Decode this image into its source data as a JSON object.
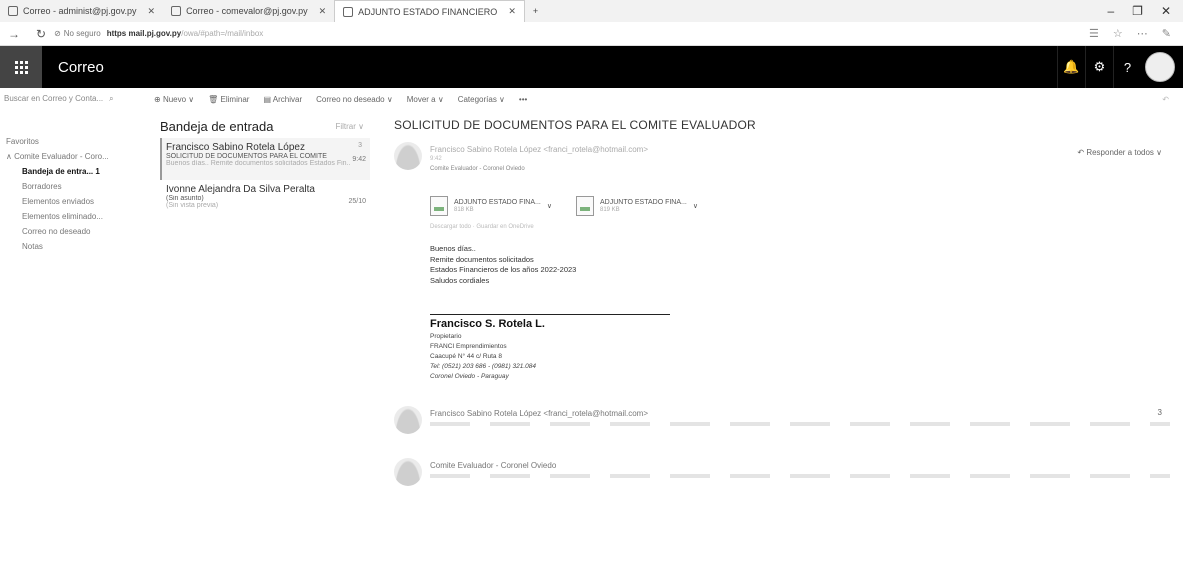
{
  "browser": {
    "tabs": [
      {
        "label": "Correo - administ@pj.gov.py"
      },
      {
        "label": "Correo - comevalor@pj.gov.py"
      },
      {
        "label": "ADJUNTO ESTADO FINANCIERO"
      }
    ],
    "security_label": "No seguro",
    "url_host": "https  mail.pj.gov.py",
    "url_path": "/owa/#path=/mail/inbox"
  },
  "app": {
    "title": "Correo"
  },
  "search": {
    "placeholder": "Buscar en Correo y Conta..."
  },
  "commands": {
    "new": "Nuevo",
    "delete": "Eliminar",
    "archive": "Archivar",
    "junk": "Correo no deseado",
    "move": "Mover a",
    "categories": "Categorías",
    "more": "•••"
  },
  "folders": {
    "favorites": "Favoritos",
    "account": "Comite Evaluador - Coro...",
    "items": [
      {
        "label": "Bandeja de entra... 1"
      },
      {
        "label": "Borradores"
      },
      {
        "label": "Elementos enviados"
      },
      {
        "label": "Elementos eliminado..."
      },
      {
        "label": "Correo no deseado"
      },
      {
        "label": "Notas"
      }
    ]
  },
  "message_list": {
    "title": "Bandeja de entrada",
    "filter": "Filtrar",
    "messages": [
      {
        "from": "Francisco Sabino Rotela López",
        "subject": "SOLICITUD DE DOCUMENTOS PARA EL COMITE",
        "preview": "Buenos días.. Remite documentos solicitados Estados Fin...",
        "time": "9:42",
        "count": "3"
      },
      {
        "from": "Ivonne Alejandra Da Silva Peralta",
        "subject": "(Sin asunto)",
        "preview": "(Sin vista previa)",
        "time": "25/10",
        "count": ""
      }
    ]
  },
  "reading": {
    "title": "SOLICITUD DE DOCUMENTOS PARA EL COMITE EVALUADOR",
    "sender": "Francisco Sabino Rotela López <franci_rotela@hotmail.com>",
    "date": "9:42",
    "to": "Comite Evaluador - Coronel Oviedo",
    "reply_all": "Responder a todos",
    "attachments": [
      {
        "name": "ADJUNTO ESTADO FINA...",
        "size": "818 KB"
      },
      {
        "name": "ADJUNTO ESTADO FINA...",
        "size": "819 KB"
      }
    ],
    "attach_actions": "Descargar todo  ·  Guardar en OneDrive",
    "body": [
      "Buenos días..",
      "Remite documentos solicitados",
      "Estados Financieros de los años 2022-2023",
      "Saludos cordiales"
    ],
    "signature": {
      "name": "Francisco S. Rotela L.",
      "lines": [
        "Propietario",
        "FRANCI Emprendimientos",
        "Caacupé N° 44 c/ Ruta 8",
        "Tel: (0521) 203 686  -  (0981) 321.084",
        "Coronel Oviedo - Paraguay"
      ]
    },
    "thread": [
      {
        "sender": "Francisco Sabino Rotela López <franci_rotela@hotmail.com>",
        "count": "3"
      },
      {
        "sender": "Comite Evaluador - Coronel Oviedo",
        "count": ""
      }
    ]
  }
}
